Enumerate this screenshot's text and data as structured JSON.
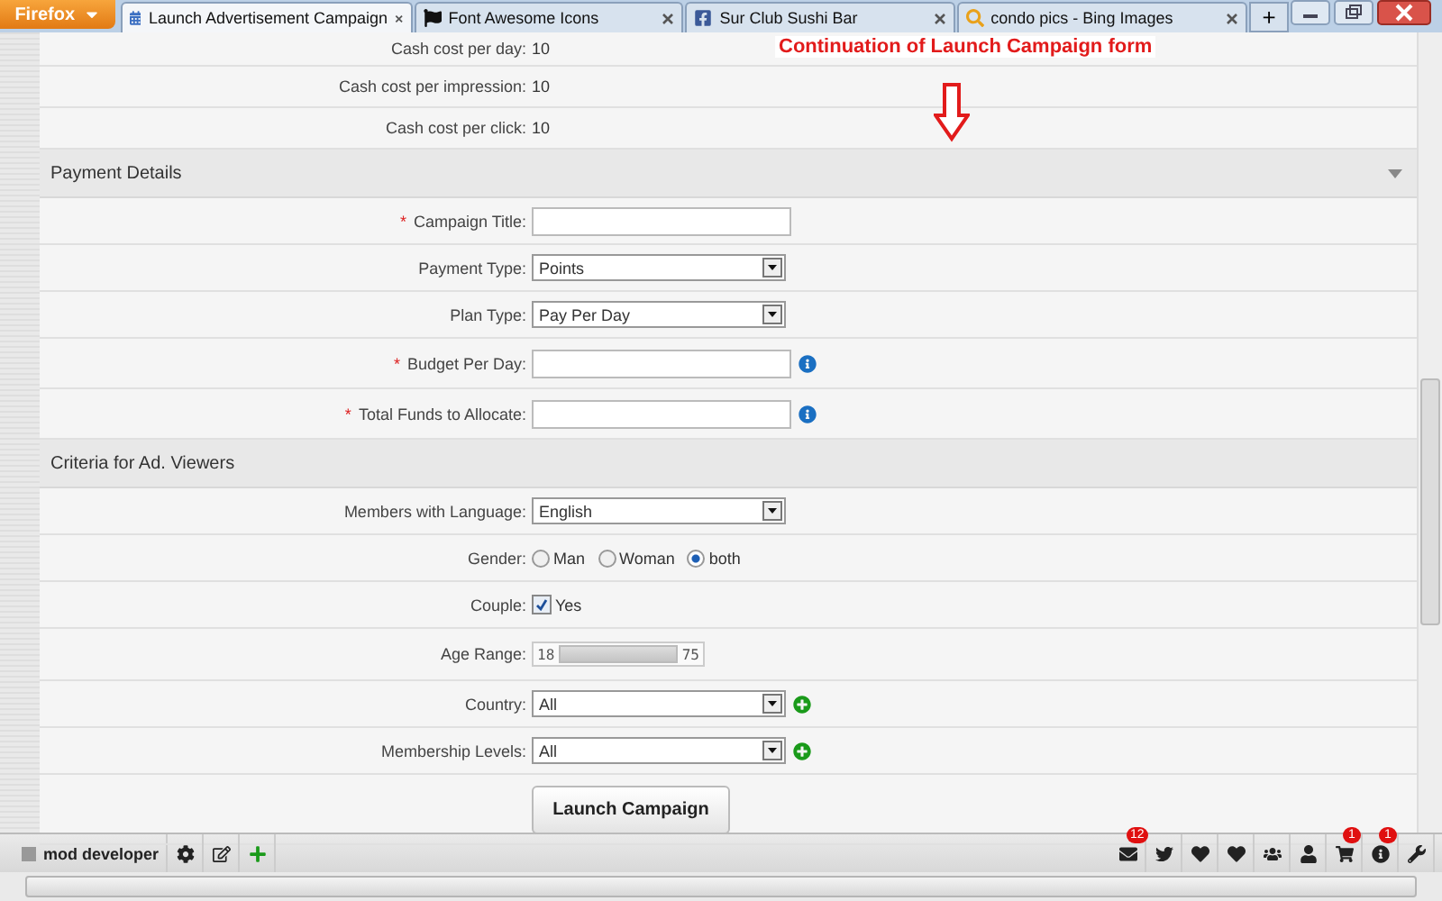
{
  "browser": {
    "menu_button": "Firefox",
    "new_tab": "+",
    "tabs": [
      {
        "label": "Launch Advertisement Campaign",
        "selected": true,
        "kind": "calendar"
      },
      {
        "label": "Font Awesome Icons",
        "selected": false,
        "kind": "flag"
      },
      {
        "label": "Sur Club Sushi Bar",
        "selected": false,
        "kind": "social"
      },
      {
        "label": "condo pics - Bing Images",
        "selected": false,
        "kind": "search"
      }
    ]
  },
  "summary_rows": [
    {
      "label": "Cash cost per day:",
      "value": "10"
    },
    {
      "label": "Cash cost per impression:",
      "value": "10"
    },
    {
      "label": "Cash cost per click:",
      "value": "10"
    }
  ],
  "annotation": {
    "text": "Continuation of Launch Campaign form"
  },
  "sections": [
    {
      "title": "Payment Details",
      "collapsible": true,
      "fields": [
        {
          "kind": "text",
          "label": "Campaign Title:",
          "required_mark": "*"
        },
        {
          "kind": "select",
          "label": "Payment Type:",
          "value": "Points"
        },
        {
          "kind": "select",
          "label": "Plan Type:",
          "value": "Pay Per Day"
        },
        {
          "kind": "text",
          "label": "Budget Per Day:",
          "required_mark": "*",
          "info": true
        },
        {
          "kind": "text",
          "label": "Total Funds to Allocate:",
          "required_mark": "*",
          "info": true
        }
      ]
    },
    {
      "title": "Criteria for Ad. Viewers",
      "fields": [
        {
          "kind": "select",
          "label": "Members with Language:",
          "value": "English"
        },
        {
          "kind": "radio",
          "label": "Gender:",
          "options": [
            {
              "label": "Man",
              "selected": false
            },
            {
              "label": "Woman",
              "selected": false
            },
            {
              "label": "both",
              "selected": true
            }
          ]
        },
        {
          "kind": "checkbox",
          "label": "Couple:",
          "option": "Yes",
          "checked": true
        },
        {
          "kind": "range",
          "label": "Age Range:",
          "low": "18",
          "high": "75",
          "level": 1
        },
        {
          "kind": "select",
          "label": "Country:",
          "value": "All",
          "add": true
        },
        {
          "kind": "select",
          "label": "Membership Levels:",
          "value": "All",
          "add": true
        }
      ]
    }
  ],
  "submit": "Launch Campaign",
  "toolbar": {
    "user": "mod developer",
    "icons": [
      {
        "kind": "mail",
        "badge": "12"
      },
      {
        "kind": "bird"
      },
      {
        "kind": "heart"
      },
      {
        "kind": "heart"
      },
      {
        "kind": "group"
      },
      {
        "kind": "user"
      },
      {
        "kind": "cart",
        "badge": "1"
      },
      {
        "kind": "info",
        "badge": "1"
      },
      {
        "kind": "wrench"
      }
    ]
  }
}
